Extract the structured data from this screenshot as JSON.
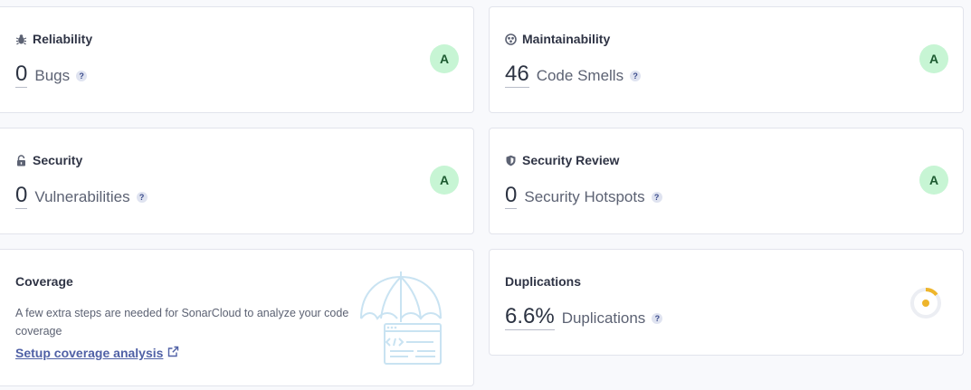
{
  "reliability": {
    "title": "Reliability",
    "icon": "bug-icon",
    "value": "0",
    "label": "Bugs",
    "grade": "A"
  },
  "maintainability": {
    "title": "Maintainability",
    "icon": "maintainability-icon",
    "value": "46",
    "label": "Code Smells",
    "grade": "A"
  },
  "security": {
    "title": "Security",
    "icon": "lock-icon",
    "value": "0",
    "label": "Vulnerabilities",
    "grade": "A"
  },
  "security_review": {
    "title": "Security Review",
    "icon": "shield-icon",
    "value": "0",
    "label": "Security Hotspots",
    "grade": "A"
  },
  "coverage": {
    "title": "Coverage",
    "description": "A few extra steps are needed for SonarCloud to analyze your code coverage",
    "link": "Setup coverage analysis",
    "illustration": "umbrella-illustration"
  },
  "duplications": {
    "title": "Duplications",
    "value": "6.6%",
    "label": "Duplications",
    "ring_fraction": 0.066
  },
  "help_glyph": "?",
  "colors": {
    "grade_bg": "#c7f5d4",
    "grade_text": "#1c5a30",
    "link": "#5061a6",
    "dup_ring": "#eeb52b"
  }
}
